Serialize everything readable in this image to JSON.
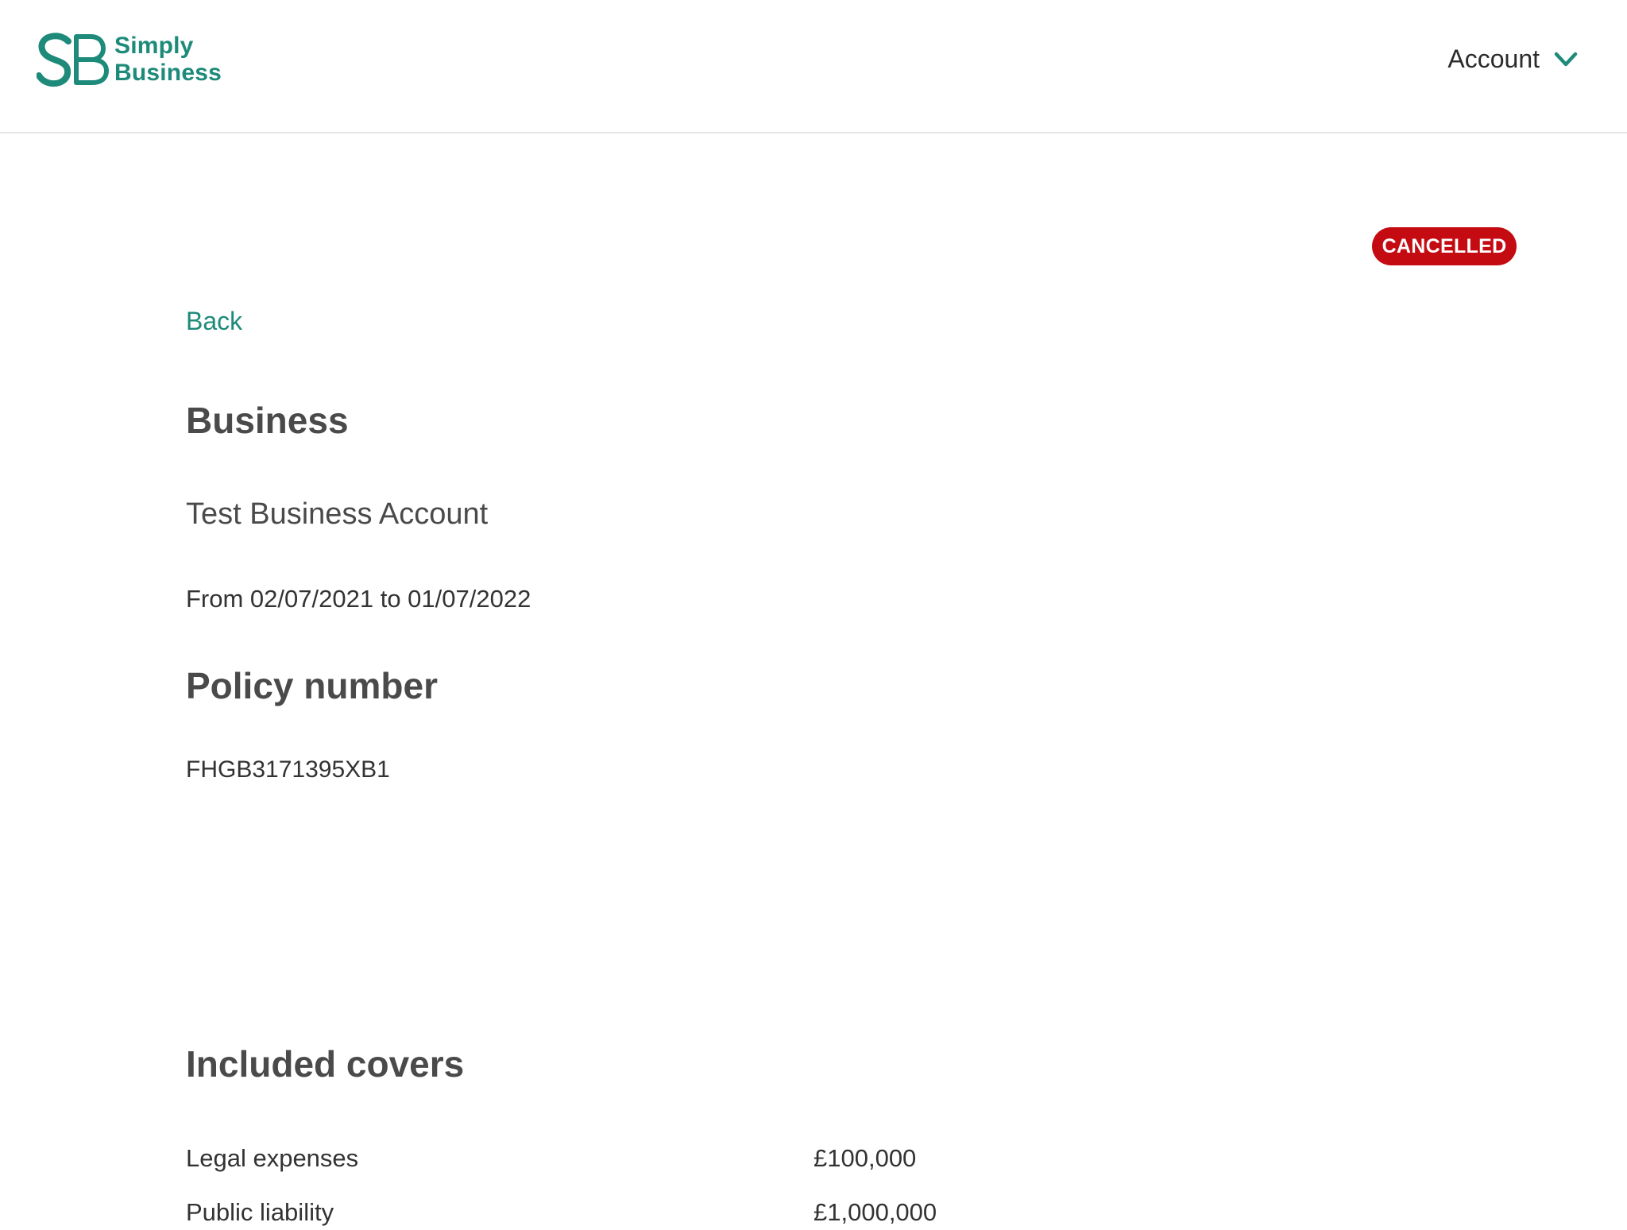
{
  "header": {
    "logo": {
      "line1": "Simply",
      "line2": "Business",
      "mark_letters": "SB",
      "color": "#1d8a7a"
    },
    "account_menu": {
      "label": "Account",
      "icon": "chevron-down-icon"
    }
  },
  "policy": {
    "status": "CANCELLED",
    "status_color": "#c40b12",
    "back_label": "Back",
    "business_heading": "Business",
    "business_name": "Test Business Account",
    "period": "From 02/07/2021 to 01/07/2022",
    "policy_number_heading": "Policy number",
    "policy_number": "FHGB3171395XB1"
  },
  "covers": {
    "heading": "Included covers",
    "items": [
      {
        "name": "Legal expenses",
        "limit": "£100,000"
      },
      {
        "name": "Public liability",
        "limit": "£1,000,000"
      }
    ]
  }
}
